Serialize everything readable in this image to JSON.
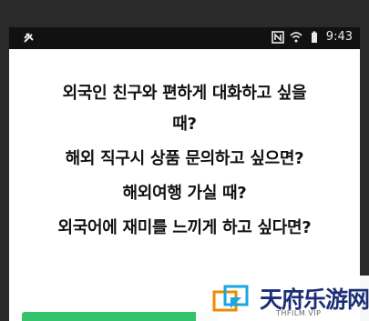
{
  "status_bar": {
    "time": "9:43",
    "icons": [
      "settings-icon",
      "nfc-icon",
      "wifi-icon",
      "battery-icon"
    ]
  },
  "promo": {
    "lines": [
      "외국인 친구와 편하게 대화하고 싶을",
      "때?",
      "해외 직구시 상품 문의하고 싶으면?",
      "해외여행 가실 때?",
      "외국어에 재미를 느끼게 하고 싶다면?"
    ]
  },
  "watermark": {
    "title": "天府乐游网",
    "subtitle": "THFILM VIP"
  }
}
